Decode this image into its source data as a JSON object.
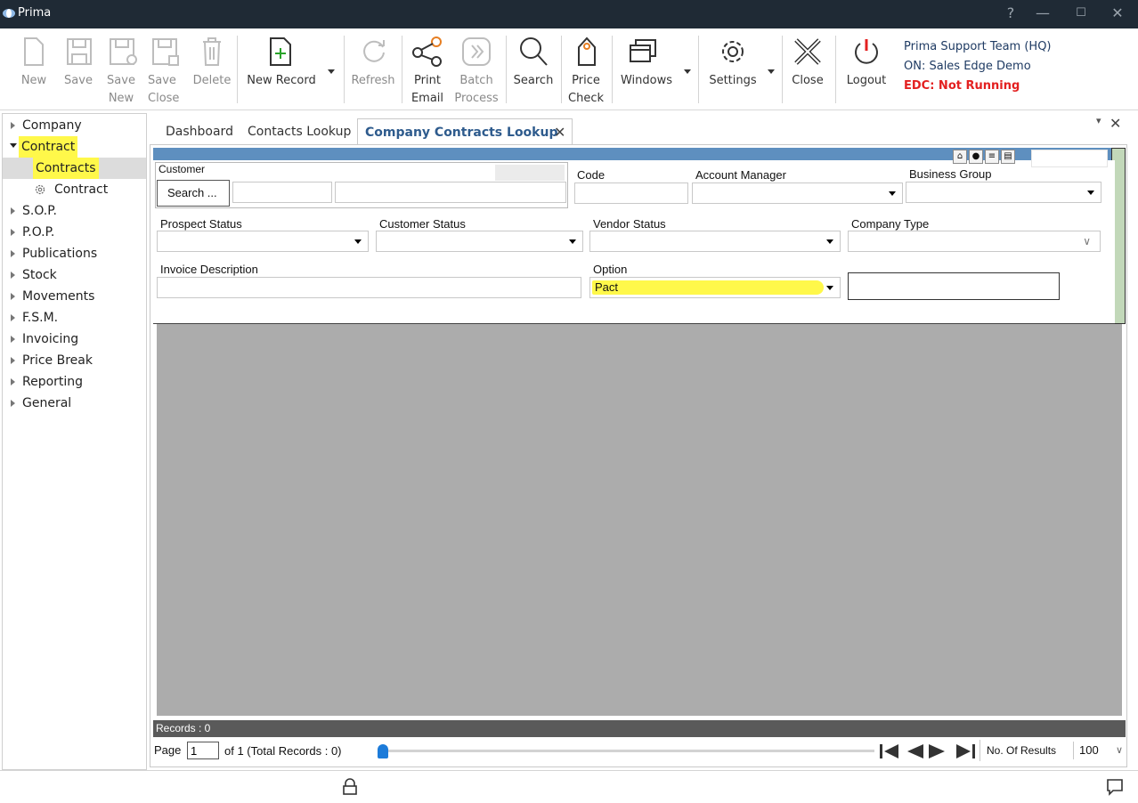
{
  "window": {
    "title": "Prima",
    "help_glyph": "?",
    "min_glyph": "—",
    "max_glyph": "☐",
    "close_glyph": "✕"
  },
  "ribbon": {
    "new_label": "New",
    "save_label": "Save",
    "save_new_line1": "Save",
    "save_new_line2": "New",
    "save_close_line1": "Save",
    "save_close_line2": "Close",
    "delete_label": "Delete",
    "new_record_label": "New Record",
    "refresh_label": "Refresh",
    "print_email_line1": "Print",
    "print_email_line2": "Email",
    "batch_process_line1": "Batch",
    "batch_process_line2": "Process",
    "search_label": "Search",
    "price_check_line1": "Price",
    "price_check_line2": "Check",
    "windows_label": "Windows",
    "settings_label": "Settings",
    "close_label": "Close",
    "logout_label": "Logout"
  },
  "user_info": {
    "team": "Prima Support Team (HQ)",
    "connection": "ON: Sales Edge Demo",
    "edc_status": "EDC: Not Running"
  },
  "sidebar": {
    "items": [
      {
        "label": "Company"
      },
      {
        "label": "Contract"
      },
      {
        "label": "Contracts"
      },
      {
        "label": "Contract"
      },
      {
        "label": "S.O.P."
      },
      {
        "label": "P.O.P."
      },
      {
        "label": "Publications"
      },
      {
        "label": "Stock"
      },
      {
        "label": "Movements"
      },
      {
        "label": "F.S.M."
      },
      {
        "label": "Invoicing"
      },
      {
        "label": "Price Break"
      },
      {
        "label": "Reporting"
      },
      {
        "label": "General"
      }
    ]
  },
  "tabs": {
    "items": [
      {
        "label": "Dashboard"
      },
      {
        "label": "Contacts Lookup"
      },
      {
        "label": "Company Contracts Lookup"
      }
    ],
    "close_glyph": "✕",
    "panel_menu_glyph": "▾",
    "panel_close_glyph": "✕"
  },
  "form": {
    "customer_label": "Customer",
    "search_button": "Search ...",
    "code_label": "Code",
    "account_manager_label": "Account Manager",
    "business_group_label": "Business Group",
    "prospect_status_label": "Prospect Status",
    "customer_status_label": "Customer Status",
    "vendor_status_label": "Vendor Status",
    "company_type_label": "Company Type",
    "invoice_description_label": "Invoice Description",
    "option_label": "Option",
    "option_value": "Pact"
  },
  "grid": {
    "records_text": "Records : 0"
  },
  "pager": {
    "page_label": "Page",
    "page_value": "1",
    "of_text": "of  1  (Total Records : 0)",
    "results_label": "No. Of Results",
    "results_value": "100"
  },
  "colors": {
    "accent": "#2e5b8d",
    "highlight": "#fff84a",
    "edc_status": "#e32020",
    "titlebar": "#1f2a35"
  }
}
